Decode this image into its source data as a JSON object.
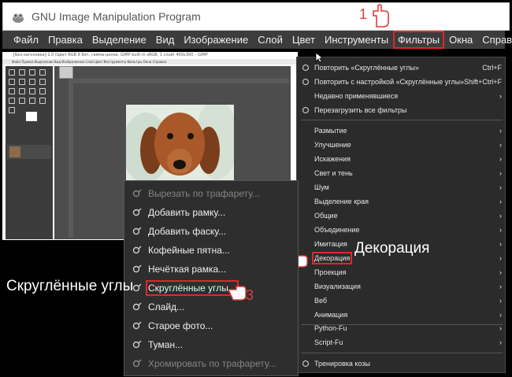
{
  "app": {
    "title": "GNU Image Manipulation Program",
    "screenshot_title": "[Без-заголовка]-1.0 (Цвет RGB 8 бит, гамма-целое, GIMP built-in sRGB, 1 слой) 400x300 – GIMP",
    "screenshot_menu": "Файл Правка Выделение Вид Изображение Слой Цвет Инструменты Фильтры Окна Справка"
  },
  "menubar": {
    "items": [
      {
        "label": "Файл"
      },
      {
        "label": "Правка"
      },
      {
        "label": "Выделение"
      },
      {
        "label": "Вид"
      },
      {
        "label": "Изображение"
      },
      {
        "label": "Слой"
      },
      {
        "label": "Цвет"
      },
      {
        "label": "Инструменты"
      },
      {
        "label": "Фильтры",
        "active": true
      },
      {
        "label": "Окна"
      },
      {
        "label": "Справка"
      }
    ]
  },
  "steps": {
    "s1": "1",
    "s2": "2",
    "s3": "3"
  },
  "annotations": {
    "decoration": "Декорация",
    "rounded": "Скруглённые углы"
  },
  "filters_menu": {
    "repeat_label": "Повторить «Скруглённые углы»",
    "repeat_shortcut": "Ctrl+F",
    "reshow_label": "Повторить с настройкой «Скруглённые углы»",
    "reshow_shortcut": "Shift+Ctrl+F",
    "recent_label": "Недавно применявшиеся",
    "reset_label": "Перезагрузить все фильтры",
    "blur_label": "Размытие",
    "enhance_label": "Улучшение",
    "distorts_label": "Искажения",
    "light_label": "Свет и тень",
    "noise_label": "Шум",
    "edge_label": "Выделение края",
    "generic_label": "Общие",
    "combine_label": "Объединение",
    "artistic_label": "Имитация",
    "decor_label": "Декорация",
    "map_label": "Проекция",
    "render_label": "Визуализация",
    "web_label": "Веб",
    "animation_label": "Анимация",
    "pythonfu_label": "Python-Fu",
    "scriptfu_label": "Script-Fu",
    "goat_label": "Тренировка козы"
  },
  "decor_menu": {
    "stencil_carve_label": "Вырезать по трафарету...",
    "add_border_label": "Добавить рамку...",
    "add_bevel_label": "Добавить фаску...",
    "coffee_label": "Кофейные пятна...",
    "fuzzy_label": "Нечёткая рамка...",
    "round_label": "Скруглённые углы...",
    "slide_label": "Слайд...",
    "oldphoto_label": "Старое фото...",
    "fog_label": "Туман...",
    "stencil_chrome_label": "Хромировать по трафарету..."
  },
  "colors": {
    "highlight": "#e0262b",
    "menu_bg": "#3c3c3c",
    "dropdown_bg": "#2b2b2b"
  },
  "icons": {
    "logo": "gimp-logo-icon",
    "plugin": "plugin-icon",
    "pointer": "pointing-hand-icon",
    "cursor": "mouse-cursor-icon",
    "submenu": "chevron-right-icon"
  }
}
